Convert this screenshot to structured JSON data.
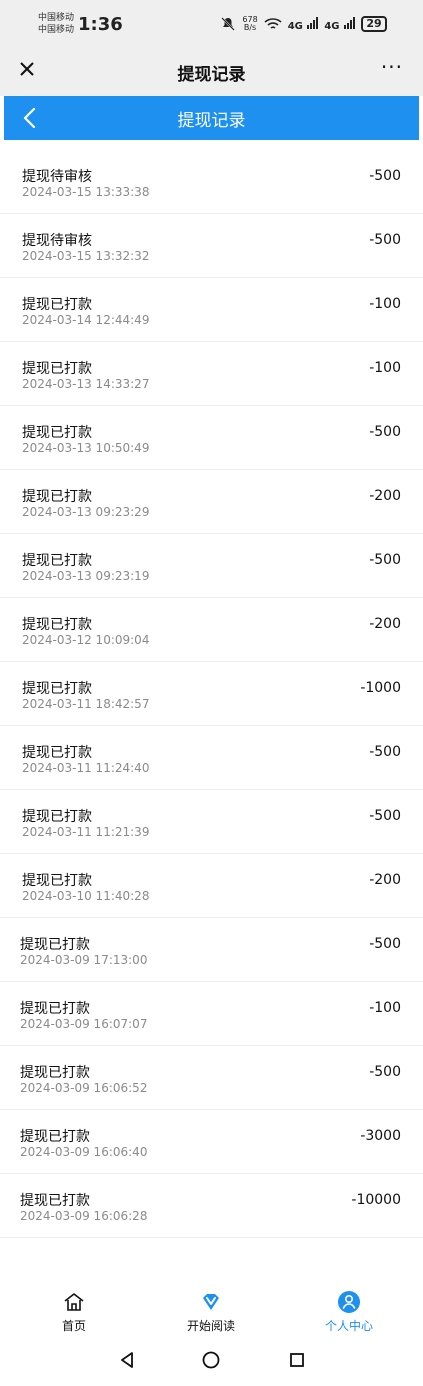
{
  "status_bar": {
    "carrier_line1": "中国移动",
    "carrier_line2": "中国移动",
    "time": "1:36",
    "net_speed_value": "678",
    "net_speed_unit": "B/s",
    "signal1_label": "4G",
    "signal2_label": "4G",
    "battery": "29"
  },
  "browser_bar": {
    "title": "提现记录",
    "more_label": "···"
  },
  "app_header": {
    "title": "提现记录"
  },
  "records": [
    {
      "title": "提现待审核",
      "date": "2024-03-15 13:33:38",
      "amount": "-500"
    },
    {
      "title": "提现待审核",
      "date": "2024-03-15 13:32:32",
      "amount": "-500"
    },
    {
      "title": "提现已打款",
      "date": "2024-03-14 12:44:49",
      "amount": "-100"
    },
    {
      "title": "提现已打款",
      "date": "2024-03-13 14:33:27",
      "amount": "-100"
    },
    {
      "title": "提现已打款",
      "date": "2024-03-13 10:50:49",
      "amount": "-500"
    },
    {
      "title": "提现已打款",
      "date": "2024-03-13 09:23:29",
      "amount": "-200"
    },
    {
      "title": "提现已打款",
      "date": "2024-03-13 09:23:19",
      "amount": "-500"
    },
    {
      "title": "提现已打款",
      "date": "2024-03-12 10:09:04",
      "amount": "-200"
    },
    {
      "title": "提现已打款",
      "date": "2024-03-11 18:42:57",
      "amount": "-1000"
    },
    {
      "title": "提现已打款",
      "date": "2024-03-11 11:24:40",
      "amount": "-500"
    },
    {
      "title": "提现已打款",
      "date": "2024-03-11 11:21:39",
      "amount": "-500"
    },
    {
      "title": "提现已打款",
      "date": "2024-03-10 11:40:28",
      "amount": "-200"
    },
    {
      "title": "提现已打款",
      "date": "2024-03-09 17:13:00",
      "amount": "-500"
    },
    {
      "title": "提现已打款",
      "date": "2024-03-09 16:07:07",
      "amount": "-100"
    },
    {
      "title": "提现已打款",
      "date": "2024-03-09 16:06:52",
      "amount": "-500"
    },
    {
      "title": "提现已打款",
      "date": "2024-03-09 16:06:40",
      "amount": "-3000"
    },
    {
      "title": "提现已打款",
      "date": "2024-03-09 16:06:28",
      "amount": "-10000"
    }
  ],
  "tabbar": {
    "tabs": [
      {
        "label": "首页",
        "icon": "home-icon"
      },
      {
        "label": "开始阅读",
        "icon": "diamond-v-icon"
      },
      {
        "label": "个人中心",
        "icon": "user-icon",
        "active": true
      }
    ]
  },
  "nav": {
    "back_icon": "nav-back-icon",
    "home_icon": "nav-home-icon",
    "recent_icon": "nav-recent-icon"
  },
  "colors": {
    "accent": "#1e90f0",
    "divider": "#eeeeee",
    "muted_text": "#8a8a8a"
  }
}
